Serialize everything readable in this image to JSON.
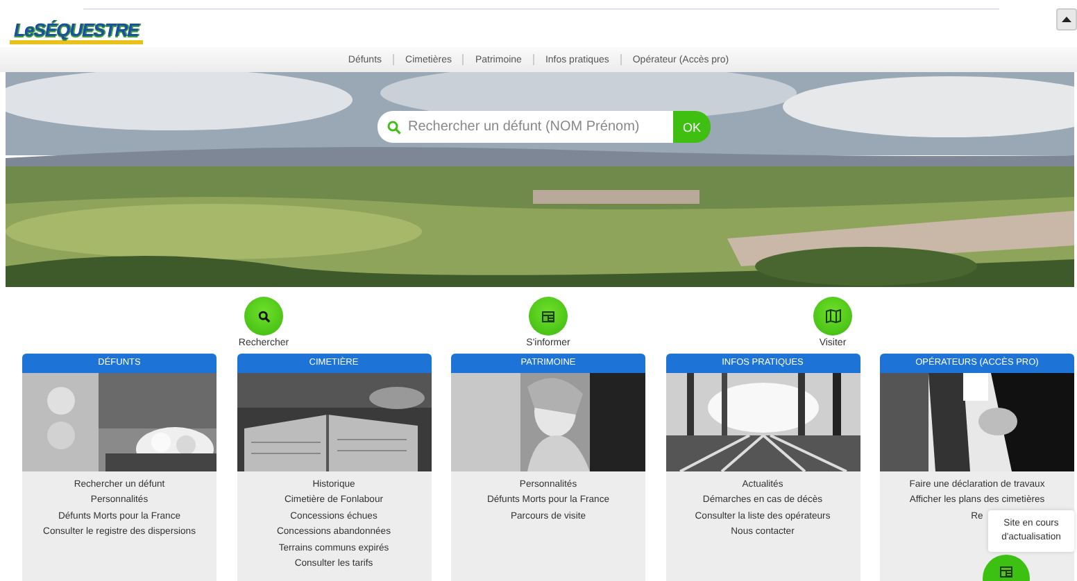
{
  "logo": {
    "text": "LeSÉQUESTRE"
  },
  "nav": [
    "Défunts",
    "Cimetières",
    "Patrimoine",
    "Infos pratiques",
    "Opérateur (Accès pro)"
  ],
  "search": {
    "placeholder": "Rechercher un défunt (NOM Prénom)",
    "button": "OK"
  },
  "actions": [
    {
      "label": "Rechercher",
      "kind": "search"
    },
    {
      "label": "S'informer",
      "kind": "news"
    },
    {
      "label": "Visiter",
      "kind": "map"
    }
  ],
  "cards": [
    {
      "title": "DÉFUNTS",
      "kind": "flowers",
      "items": [
        "Rechercher un défunt",
        "Personnalités",
        "Défunts Morts pour la France",
        "Consulter le registre des dispersions"
      ]
    },
    {
      "title": "CIMETIÈRE",
      "kind": "book",
      "items": [
        "Historique",
        "Cimetière de Fonlabour",
        "Concessions échues",
        "Concessions abandonnées",
        "Terrains communs expirés",
        "Consulter les tarifs"
      ]
    },
    {
      "title": "PATRIMOINE",
      "kind": "statue",
      "items": [
        "Personnalités",
        "Défunts Morts pour la France",
        "Parcours de visite"
      ]
    },
    {
      "title": "INFOS PRATIQUES",
      "kind": "forest",
      "items": [
        "Actualités",
        "Démarches en cas de décès",
        "Consulter la liste des opérateurs",
        "Nous contacter"
      ]
    },
    {
      "title": "OPÉRATEURS (ACCÈS PRO)",
      "kind": "hands",
      "items": [
        "Faire une déclaration de travaux",
        "Afficher les plans des cimetières",
        "Re"
      ]
    }
  ],
  "tooltip": {
    "text": "Site en cours d'actualisation",
    "kind": "news"
  }
}
